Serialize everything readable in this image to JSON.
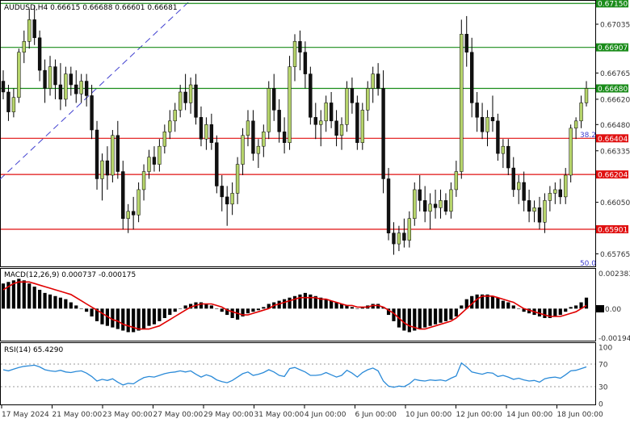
{
  "colors": {
    "background": "#ffffff",
    "bull_candle": "#b6d46b",
    "bear_candle": "#111111",
    "green_line": "#1a8c1a",
    "red_line": "#e01010",
    "blue_line": "#4040d0",
    "macd_hist": "#000000",
    "macd_signal": "#e00000",
    "rsi_line": "#2a8ad8",
    "grid_text": "#333333"
  },
  "chart_data": [
    {
      "type": "candlestick",
      "title": "AUDUSD,H4  0.66615 0.66688 0.66601 0.66681",
      "ylim": [
        0.657,
        0.6716
      ],
      "y_ticks": [
        0.67035,
        0.66765,
        0.6662,
        0.6648,
        0.66335,
        0.6605,
        0.65765
      ],
      "x_tick_labels": [
        "17 May 2024",
        "21 May 00:00",
        "23 May 00:00",
        "27 May 00:00",
        "29 May 00:00",
        "31 May 00:00",
        "4 Jun 00:00",
        "6 Jun 00:00",
        "10 Jun 00:00",
        "12 Jun 00:00",
        "14 Jun 00:00",
        "18 Jun 00:00"
      ],
      "horizontal_levels": [
        {
          "value": 0.6715,
          "label": "0.67150",
          "color": "#1a8c1a"
        },
        {
          "value": 0.66907,
          "label": "0.66907",
          "color": "#1a8c1a"
        },
        {
          "value": 0.6668,
          "label": "0.66680",
          "color": "#1a8c1a"
        },
        {
          "value": 0.66404,
          "label": "0.66404",
          "color": "#e01010"
        },
        {
          "value": 0.66204,
          "label": "0.66204",
          "color": "#e01010"
        },
        {
          "value": 0.65901,
          "label": "0.65901",
          "color": "#e01010"
        }
      ],
      "fib_labels": [
        {
          "text": "38.2",
          "value": 0.66404
        },
        {
          "text": "50.0",
          "value": 0.6571
        }
      ],
      "candles": [
        [
          0.6672,
          0.6678,
          0.6662,
          0.6666
        ],
        [
          0.6666,
          0.667,
          0.665,
          0.6655
        ],
        [
          0.6655,
          0.6668,
          0.6652,
          0.6663
        ],
        [
          0.6663,
          0.669,
          0.666,
          0.6688
        ],
        [
          0.6688,
          0.67,
          0.6682,
          0.6694
        ],
        [
          0.6694,
          0.6712,
          0.669,
          0.6706
        ],
        [
          0.6706,
          0.6714,
          0.6692,
          0.6696
        ],
        [
          0.6696,
          0.67,
          0.6672,
          0.6678
        ],
        [
          0.6678,
          0.6684,
          0.666,
          0.6668
        ],
        [
          0.6668,
          0.6686,
          0.6664,
          0.668
        ],
        [
          0.668,
          0.6684,
          0.6662,
          0.667
        ],
        [
          0.667,
          0.6682,
          0.6656,
          0.6662
        ],
        [
          0.6662,
          0.668,
          0.6658,
          0.6676
        ],
        [
          0.6676,
          0.668,
          0.6664,
          0.667
        ],
        [
          0.667,
          0.6678,
          0.666,
          0.6665
        ],
        [
          0.6665,
          0.6676,
          0.666,
          0.6672
        ],
        [
          0.6672,
          0.6676,
          0.6658,
          0.6664
        ],
        [
          0.6664,
          0.667,
          0.664,
          0.6645
        ],
        [
          0.6645,
          0.665,
          0.6612,
          0.6618
        ],
        [
          0.6618,
          0.6632,
          0.6606,
          0.6628
        ],
        [
          0.6628,
          0.6636,
          0.6612,
          0.662
        ],
        [
          0.662,
          0.6645,
          0.6616,
          0.6642
        ],
        [
          0.6642,
          0.665,
          0.6618,
          0.6622
        ],
        [
          0.6622,
          0.6628,
          0.659,
          0.6596
        ],
        [
          0.6596,
          0.6604,
          0.6588,
          0.66
        ],
        [
          0.66,
          0.6608,
          0.659,
          0.6598
        ],
        [
          0.6598,
          0.6616,
          0.6594,
          0.6612
        ],
        [
          0.6612,
          0.6626,
          0.6606,
          0.6622
        ],
        [
          0.6622,
          0.6634,
          0.6618,
          0.663
        ],
        [
          0.663,
          0.6636,
          0.6622,
          0.6626
        ],
        [
          0.6626,
          0.664,
          0.6622,
          0.6636
        ],
        [
          0.6636,
          0.6648,
          0.6632,
          0.6644
        ],
        [
          0.6644,
          0.6656,
          0.664,
          0.665
        ],
        [
          0.665,
          0.666,
          0.6644,
          0.6656
        ],
        [
          0.6656,
          0.667,
          0.6652,
          0.6666
        ],
        [
          0.6666,
          0.6676,
          0.6656,
          0.666
        ],
        [
          0.666,
          0.6674,
          0.6654,
          0.667
        ],
        [
          0.667,
          0.6676,
          0.6648,
          0.6652
        ],
        [
          0.6652,
          0.6658,
          0.6636,
          0.664
        ],
        [
          0.664,
          0.6652,
          0.6634,
          0.6648
        ],
        [
          0.6648,
          0.6654,
          0.6634,
          0.6638
        ],
        [
          0.6638,
          0.6642,
          0.661,
          0.6614
        ],
        [
          0.6614,
          0.662,
          0.66,
          0.6608
        ],
        [
          0.6608,
          0.6614,
          0.6592,
          0.6604
        ],
        [
          0.6604,
          0.6616,
          0.6598,
          0.661
        ],
        [
          0.661,
          0.663,
          0.6604,
          0.6626
        ],
        [
          0.6626,
          0.6646,
          0.662,
          0.6642
        ],
        [
          0.6642,
          0.6656,
          0.6636,
          0.665
        ],
        [
          0.665,
          0.6656,
          0.6628,
          0.6632
        ],
        [
          0.6632,
          0.664,
          0.6624,
          0.6636
        ],
        [
          0.6636,
          0.6648,
          0.663,
          0.6644
        ],
        [
          0.6644,
          0.6672,
          0.664,
          0.6668
        ],
        [
          0.6668,
          0.6676,
          0.665,
          0.6656
        ],
        [
          0.6656,
          0.6662,
          0.6638,
          0.6644
        ],
        [
          0.6644,
          0.6652,
          0.6632,
          0.6638
        ],
        [
          0.6638,
          0.6686,
          0.6634,
          0.668
        ],
        [
          0.668,
          0.6698,
          0.6672,
          0.6694
        ],
        [
          0.6694,
          0.67,
          0.6678,
          0.6688
        ],
        [
          0.6688,
          0.6694,
          0.6668,
          0.6676
        ],
        [
          0.6676,
          0.668,
          0.6648,
          0.6652
        ],
        [
          0.6652,
          0.666,
          0.664,
          0.6648
        ],
        [
          0.6648,
          0.6656,
          0.6636,
          0.665
        ],
        [
          0.665,
          0.6664,
          0.6644,
          0.666
        ],
        [
          0.666,
          0.6666,
          0.6646,
          0.665
        ],
        [
          0.665,
          0.6656,
          0.6636,
          0.6642
        ],
        [
          0.6642,
          0.6652,
          0.6634,
          0.6648
        ],
        [
          0.6648,
          0.6672,
          0.6644,
          0.6668
        ],
        [
          0.6668,
          0.6674,
          0.6654,
          0.666
        ],
        [
          0.666,
          0.6664,
          0.6634,
          0.6638
        ],
        [
          0.6638,
          0.666,
          0.6634,
          0.6656
        ],
        [
          0.6656,
          0.6672,
          0.665,
          0.6668
        ],
        [
          0.6668,
          0.668,
          0.666,
          0.6676
        ],
        [
          0.6676,
          0.6682,
          0.6664,
          0.6668
        ],
        [
          0.6668,
          0.6678,
          0.661,
          0.6618
        ],
        [
          0.6618,
          0.6624,
          0.6584,
          0.6588
        ],
        [
          0.6588,
          0.6594,
          0.6576,
          0.6582
        ],
        [
          0.6582,
          0.6592,
          0.6578,
          0.6588
        ],
        [
          0.6588,
          0.6596,
          0.658,
          0.6584
        ],
        [
          0.6584,
          0.66,
          0.658,
          0.6596
        ],
        [
          0.6596,
          0.6616,
          0.6592,
          0.6612
        ],
        [
          0.6612,
          0.662,
          0.66,
          0.6606
        ],
        [
          0.6606,
          0.6614,
          0.6594,
          0.66
        ],
        [
          0.66,
          0.661,
          0.659,
          0.6604
        ],
        [
          0.6604,
          0.6612,
          0.6596,
          0.6602
        ],
        [
          0.6602,
          0.6612,
          0.6596,
          0.6606
        ],
        [
          0.6606,
          0.661,
          0.6598,
          0.66
        ],
        [
          0.66,
          0.6616,
          0.6596,
          0.6612
        ],
        [
          0.6612,
          0.6628,
          0.6608,
          0.6622
        ],
        [
          0.6622,
          0.6706,
          0.6618,
          0.6698
        ],
        [
          0.6698,
          0.6708,
          0.668,
          0.6688
        ],
        [
          0.6688,
          0.6696,
          0.6652,
          0.666
        ],
        [
          0.666,
          0.6666,
          0.6644,
          0.6652
        ],
        [
          0.6652,
          0.666,
          0.664,
          0.6644
        ],
        [
          0.6644,
          0.6656,
          0.6636,
          0.6652
        ],
        [
          0.6652,
          0.6664,
          0.6644,
          0.665
        ],
        [
          0.665,
          0.6654,
          0.6628,
          0.6632
        ],
        [
          0.6632,
          0.664,
          0.6624,
          0.6636
        ],
        [
          0.6636,
          0.664,
          0.662,
          0.6624
        ],
        [
          0.6624,
          0.663,
          0.6608,
          0.6612
        ],
        [
          0.6612,
          0.662,
          0.6604,
          0.6616
        ],
        [
          0.6616,
          0.6622,
          0.66,
          0.6606
        ],
        [
          0.6606,
          0.6612,
          0.6594,
          0.66
        ],
        [
          0.66,
          0.6606,
          0.6594,
          0.6602
        ],
        [
          0.6602,
          0.6608,
          0.659,
          0.6594
        ],
        [
          0.6594,
          0.661,
          0.6588,
          0.6606
        ],
        [
          0.6606,
          0.6614,
          0.66,
          0.661
        ],
        [
          0.661,
          0.6616,
          0.6604,
          0.6612
        ],
        [
          0.6612,
          0.6618,
          0.6604,
          0.6608
        ],
        [
          0.6608,
          0.6624,
          0.6604,
          0.662
        ],
        [
          0.662,
          0.6648,
          0.6616,
          0.6646
        ],
        [
          0.6646,
          0.6652,
          0.664,
          0.665
        ],
        [
          0.665,
          0.6664,
          0.6646,
          0.666
        ],
        [
          0.666,
          0.6672,
          0.6658,
          0.6668
        ]
      ]
    },
    {
      "type": "bar",
      "title": "MACD(12,26,9) 0.000737 -0.000175",
      "y_tick_labels": [
        "0.002383",
        "0.00",
        "-0.00194"
      ],
      "ylim": [
        -0.00194,
        0.002383
      ],
      "histogram": [
        0.0016,
        0.0017,
        0.0018,
        0.0019,
        0.0018,
        0.0016,
        0.0014,
        0.0012,
        0.001,
        0.0009,
        0.0008,
        0.0007,
        0.0006,
        0.0004,
        0.0002,
        0.0,
        -0.0002,
        -0.0005,
        -0.0008,
        -0.001,
        -0.0011,
        -0.0012,
        -0.0013,
        -0.0014,
        -0.0015,
        -0.0015,
        -0.0014,
        -0.0013,
        -0.0011,
        -0.001,
        -0.0008,
        -0.0006,
        -0.0004,
        -0.0002,
        0.0,
        0.0002,
        0.0003,
        0.0004,
        0.0004,
        0.0003,
        0.0002,
        0.0,
        -0.0002,
        -0.0004,
        -0.0006,
        -0.0007,
        -0.0005,
        -0.0003,
        -0.0002,
        -0.0001,
        0.0001,
        0.0003,
        0.0004,
        0.0005,
        0.0006,
        0.0007,
        0.0008,
        0.0009,
        0.001,
        0.0009,
        0.0008,
        0.0007,
        0.0006,
        0.0005,
        0.0004,
        0.0003,
        0.0002,
        0.0001,
        0.0,
        0.0001,
        0.0002,
        0.0003,
        0.0003,
        0.0001,
        -0.0004,
        -0.0008,
        -0.0012,
        -0.0014,
        -0.0015,
        -0.0014,
        -0.0013,
        -0.0012,
        -0.0011,
        -0.001,
        -0.0009,
        -0.0008,
        -0.0007,
        -0.0005,
        0.0002,
        0.0006,
        0.0008,
        0.0009,
        0.0009,
        0.0009,
        0.0008,
        0.0007,
        0.0005,
        0.0004,
        0.0002,
        0.0,
        -0.0002,
        -0.0003,
        -0.0004,
        -0.0005,
        -0.0006,
        -0.0006,
        -0.0005,
        -0.0004,
        -0.0002,
        0.0001,
        0.0002,
        0.0004,
        0.0007
      ],
      "signal": [
        0.0012,
        0.0014,
        0.0016,
        0.0017,
        0.0017,
        0.0017,
        0.0016,
        0.0015,
        0.0014,
        0.0013,
        0.0012,
        0.0011,
        0.001,
        0.0009,
        0.0007,
        0.0005,
        0.0003,
        0.0001,
        -0.0001,
        -0.0003,
        -0.0005,
        -0.0007,
        -0.0008,
        -0.001,
        -0.0011,
        -0.0012,
        -0.0013,
        -0.0013,
        -0.0013,
        -0.0012,
        -0.0011,
        -0.0009,
        -0.0007,
        -0.0005,
        -0.0003,
        -0.0001,
        0.0001,
        0.0002,
        0.0003,
        0.0003,
        0.0003,
        0.0002,
        0.0001,
        -0.0001,
        -0.0002,
        -0.0003,
        -0.0004,
        -0.0004,
        -0.0003,
        -0.0002,
        -0.0001,
        0.0,
        0.0002,
        0.0003,
        0.0004,
        0.0005,
        0.0006,
        0.0007,
        0.0007,
        0.0007,
        0.0007,
        0.0006,
        0.0006,
        0.0005,
        0.0004,
        0.0003,
        0.0002,
        0.0002,
        0.0001,
        0.0001,
        0.0001,
        0.0002,
        0.0002,
        0.0001,
        -0.0001,
        -0.0003,
        -0.0006,
        -0.0009,
        -0.0011,
        -0.0012,
        -0.0013,
        -0.0013,
        -0.0012,
        -0.0011,
        -0.001,
        -0.0009,
        -0.0008,
        -0.0006,
        -0.0003,
        0.0,
        0.0003,
        0.0006,
        0.0008,
        0.0008,
        0.0008,
        0.0007,
        0.0006,
        0.0005,
        0.0004,
        0.0002,
        0.0,
        -0.0001,
        -0.0002,
        -0.0003,
        -0.0004,
        -0.0005,
        -0.0005,
        -0.0005,
        -0.0004,
        -0.0003,
        -0.0002,
        0.0,
        0.0002
      ]
    },
    {
      "type": "line",
      "title": "RSI(14) 65.4290",
      "ylim": [
        0,
        100
      ],
      "y_ticks": [
        100,
        70,
        30,
        0
      ],
      "levels": [
        70,
        30
      ],
      "values": [
        60,
        58,
        61,
        64,
        66,
        67,
        68,
        65,
        60,
        58,
        57,
        59,
        56,
        55,
        57,
        58,
        54,
        48,
        40,
        43,
        41,
        44,
        38,
        33,
        36,
        35,
        41,
        46,
        48,
        47,
        50,
        53,
        55,
        56,
        58,
        56,
        58,
        52,
        47,
        51,
        48,
        42,
        39,
        37,
        41,
        47,
        53,
        56,
        50,
        52,
        55,
        60,
        56,
        50,
        48,
        62,
        64,
        60,
        56,
        50,
        50,
        51,
        55,
        51,
        47,
        50,
        59,
        54,
        47,
        55,
        60,
        63,
        58,
        40,
        31,
        29,
        31,
        30,
        35,
        43,
        41,
        40,
        42,
        41,
        42,
        40,
        45,
        49,
        72,
        65,
        56,
        54,
        52,
        55,
        54,
        48,
        50,
        47,
        43,
        45,
        42,
        40,
        41,
        38,
        44,
        46,
        47,
        45,
        51,
        58,
        59,
        62,
        65
      ]
    }
  ]
}
